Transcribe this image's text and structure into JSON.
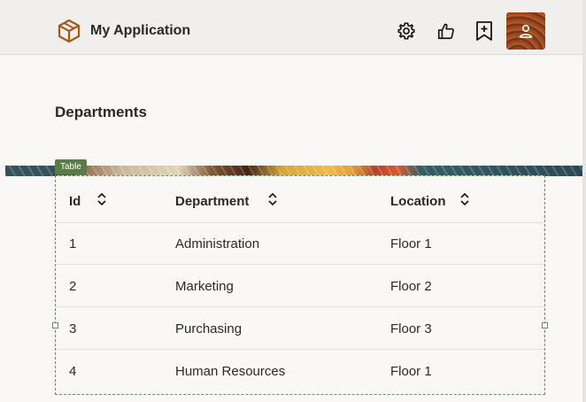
{
  "header": {
    "app_title": "My Application"
  },
  "page": {
    "title": "Departments",
    "table_tag": "Table"
  },
  "table": {
    "columns": [
      "Id",
      "Department",
      "Location"
    ],
    "rows": [
      {
        "id": "1",
        "department": "Administration",
        "location": "Floor 1"
      },
      {
        "id": "2",
        "department": "Marketing",
        "location": "Floor 2"
      },
      {
        "id": "3",
        "department": "Purchasing",
        "location": "Floor 3"
      },
      {
        "id": "4",
        "department": "Human Resources",
        "location": "Floor 1"
      }
    ]
  },
  "colors": {
    "header_bg": "#f1efed",
    "content_bg": "#f9f8f6",
    "logo_accent": "#a15c1e",
    "table_tag_bg": "#5b7a4a"
  }
}
